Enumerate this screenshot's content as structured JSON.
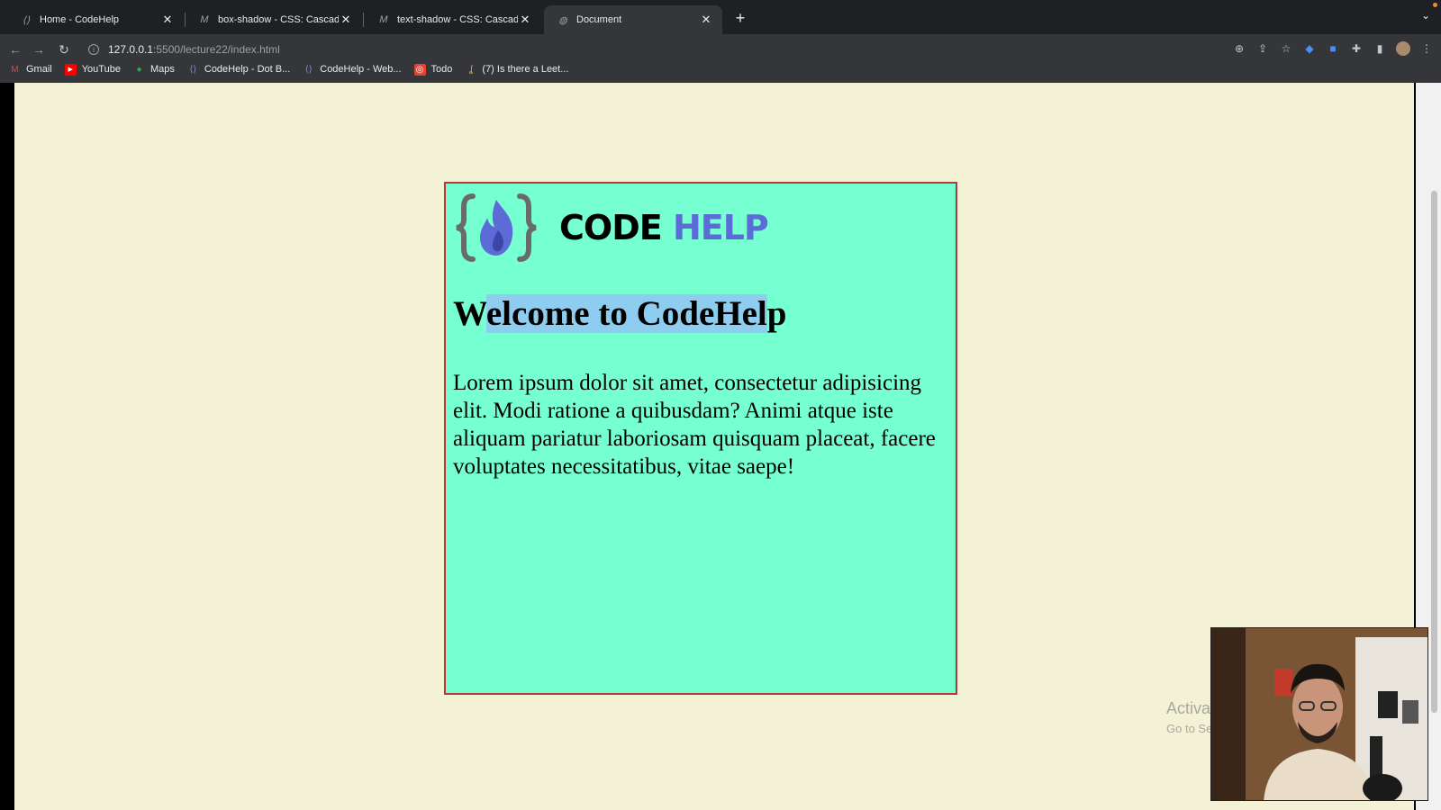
{
  "tabs": [
    {
      "title": "Home - CodeHelp",
      "favicon": "codehelp-icon",
      "active": false
    },
    {
      "title": "box-shadow - CSS: Cascading",
      "favicon": "mdn-icon",
      "active": false
    },
    {
      "title": "text-shadow - CSS: Cascading",
      "favicon": "mdn-icon",
      "active": false
    },
    {
      "title": "Document",
      "favicon": "globe-icon",
      "active": true
    }
  ],
  "address": {
    "host": "127.0.0.1",
    "path": ":5500/lecture22/index.html"
  },
  "bookmarks": [
    {
      "label": "Gmail",
      "icon": "gmail-icon"
    },
    {
      "label": "YouTube",
      "icon": "youtube-icon"
    },
    {
      "label": "Maps",
      "icon": "maps-icon"
    },
    {
      "label": "CodeHelp - Dot B...",
      "icon": "codehelp-icon"
    },
    {
      "label": "CodeHelp - Web...",
      "icon": "codehelp-icon"
    },
    {
      "label": "Todo",
      "icon": "todo-icon"
    },
    {
      "label": "(7) Is there a Leet...",
      "icon": "leetcode-icon"
    }
  ],
  "page": {
    "background": "#f3f1d6",
    "card": {
      "background": "#76ffd0",
      "border": "#b43a3a",
      "logo_code": "CODE",
      "logo_help": "HELP",
      "heading_pre": "W",
      "heading_selected": "elcome to CodeHel",
      "heading_post": "p",
      "body": "Lorem ipsum dolor sit amet, consectetur adipisicing elit. Modi ratione a quibusdam? Animi atque iste aliquam pariatur laboriosam quisquam placeat, facere voluptates necessitatibus, vitae saepe!"
    }
  },
  "watermark": {
    "line1": "Activate Windows",
    "line2": "Go to Settings to activate Windows."
  },
  "colors": {
    "logo_blue": "#5c6bd6",
    "selection": "#8ecdf0"
  }
}
